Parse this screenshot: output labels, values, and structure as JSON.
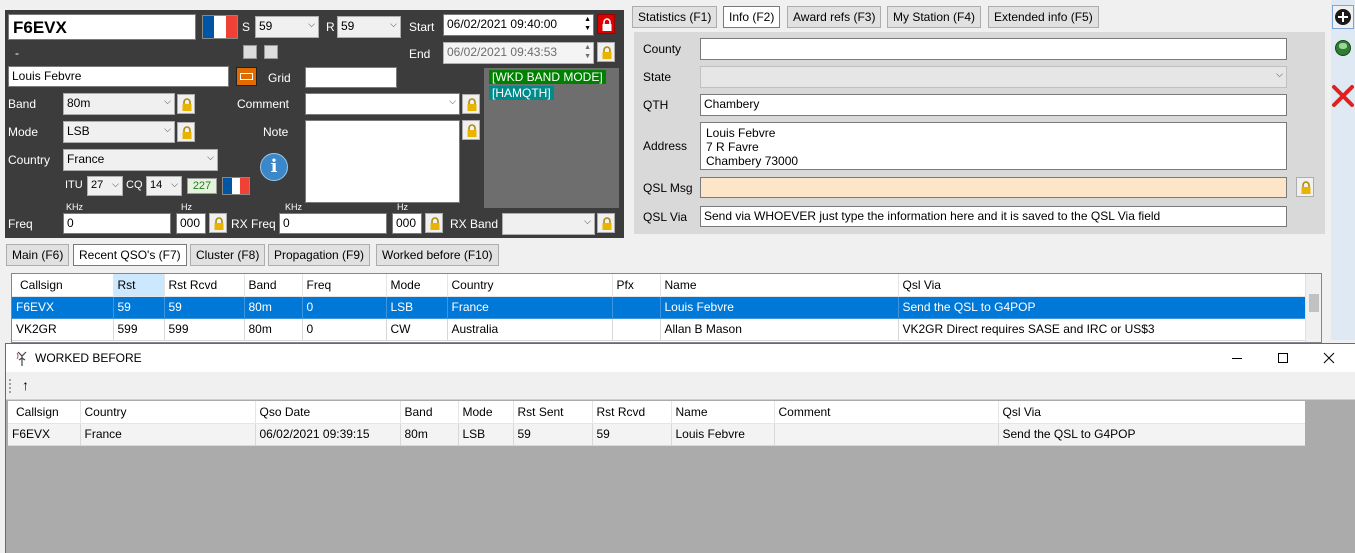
{
  "entry": {
    "callsign": "F6EVX",
    "dash": "-",
    "name": "Louis Febvre",
    "s_label": "S",
    "s_value": "59",
    "r_label": "R",
    "r_value": "59",
    "start_label": "Start",
    "start_value": "06/02/2021 09:40:00",
    "end_label": "End",
    "end_value": "06/02/2021 09:43:53",
    "grid_label": "Grid",
    "grid_value": "",
    "band_label": "Band",
    "band_value": "80m",
    "mode_label": "Mode",
    "mode_value": "LSB",
    "country_label": "Country",
    "country_value": "France",
    "comment_label": "Comment",
    "comment_value": "",
    "note_label": "Note",
    "itu_label": "ITU",
    "itu_value": "27",
    "cq_label": "CQ",
    "cq_value": "14",
    "dxcc_value": "227",
    "khz_label": "KHz",
    "hz_label": "Hz",
    "freq_label": "Freq",
    "freq_value": "0",
    "freq_hz_value": "000",
    "rxfreq_label": "RX Freq",
    "rxfreq_value": "0",
    "rxfreq_hz_value": "000",
    "rxband_label": "RX Band",
    "rxband_value": "",
    "flags": [
      "[WKD BAND MODE]",
      "[HAMQTH]"
    ],
    "colors": {
      "panel": "#3c3c3c",
      "status_panel": "#6e6e6e",
      "wkd": "#008000",
      "hamqth": "#008b8b"
    }
  },
  "info_tabs": [
    "Statistics (F1)",
    "Info (F2)",
    "Award refs (F3)",
    "My Station (F4)",
    "Extended info (F5)"
  ],
  "info": {
    "county_label": "County",
    "county_value": "",
    "state_label": "State",
    "state_value": "",
    "qth_label": "QTH",
    "qth_value": "Chambery",
    "address_label": "Address",
    "address_lines": [
      "Louis Febvre",
      "7 R Favre",
      "Chambery 73000"
    ],
    "qslmsg_label": "QSL Msg",
    "qslmsg_value": "",
    "qslvia_label": "QSL Via",
    "qslvia_value": "Send via WHOEVER just type the information here and it is saved to the QSL Via field"
  },
  "lower_tabs": [
    "Main (F6)",
    "Recent QSO's (F7)",
    "Cluster (F8)",
    "Propagation (F9)",
    "Worked before (F10)"
  ],
  "recent": {
    "columns": [
      "Callsign",
      "Rst",
      "Rst Rcvd",
      "Band",
      "Freq",
      "Mode",
      "Country",
      "Pfx",
      "Name",
      "Qsl Via"
    ],
    "rows": [
      [
        "F6EVX",
        "59",
        "59",
        "80m",
        "0",
        "LSB",
        "France",
        "",
        "Louis Febvre",
        "Send the QSL to G4POP"
      ],
      [
        "VK2GR",
        "599",
        "599",
        "80m",
        "0",
        "CW",
        "Australia",
        "",
        "Allan B Mason",
        "VK2GR Direct requires SASE and IRC or US$3"
      ]
    ]
  },
  "worked_before": {
    "title": "WORKED BEFORE",
    "toolbar_arrow": "↑",
    "columns": [
      "Callsign",
      "Country",
      "Qso Date",
      "Band",
      "Mode",
      "Rst Sent",
      "Rst Rcvd",
      "Name",
      "Comment",
      "Qsl Via"
    ],
    "rows": [
      [
        "F6EVX",
        "France",
        "06/02/2021 09:39:15",
        "80m",
        "LSB",
        "59",
        "59",
        "Louis Febvre",
        "",
        "Send the QSL to G4POP"
      ]
    ]
  }
}
